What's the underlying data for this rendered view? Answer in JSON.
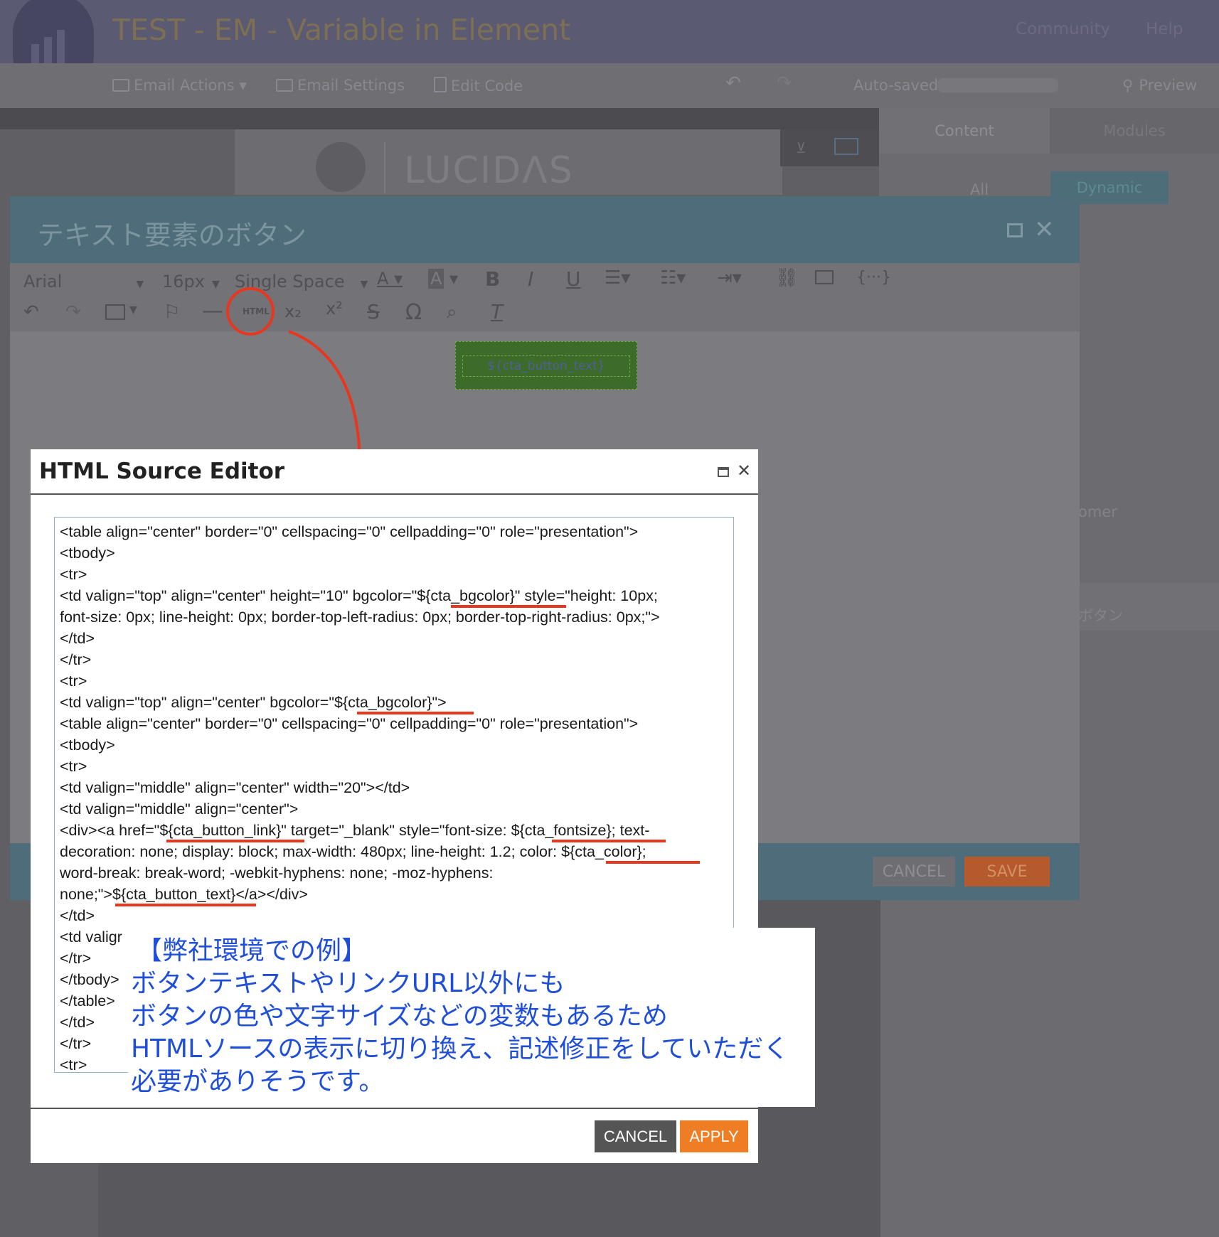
{
  "app": {
    "title": "TEST - EM - Variable in Element",
    "community": "Community",
    "help": "Help"
  },
  "toolbar": {
    "email_actions": "Email Actions ▾",
    "email_settings": "Email Settings",
    "edit_code": "Edit Code",
    "auto_saved": "Auto-saved:",
    "preview": "Preview"
  },
  "email_preview": {
    "brand": "LUCIDΛS"
  },
  "right_panel": {
    "tab_content": "Content",
    "tab_modules": "Modules",
    "filter_all": "All",
    "filter_dynamic": "Dynamic",
    "item_omer": "omer",
    "item_button": "ボタン"
  },
  "text_element_modal": {
    "title": "テキスト要素のボタン",
    "font": "Arial",
    "font_size": "16px",
    "line_spacing": "Single Space",
    "html_tool": "HTML",
    "cta_placeholder": "${cta_button_text}",
    "cancel": "CANCEL",
    "save": "SAVE"
  },
  "source_editor": {
    "title": "HTML Source Editor",
    "code_lines": [
      "<table align=\"center\" border=\"0\" cellspacing=\"0\" cellpadding=\"0\" role=\"presentation\">",
      "<tbody>",
      "<tr>",
      "<td valign=\"top\" align=\"center\" height=\"10\" bgcolor=\"${cta_bgcolor}\" style=\"height: 10px;",
      "font-size: 0px; line-height: 0px; border-top-left-radius: 0px; border-top-right-radius: 0px;\">",
      "</td>",
      "</tr>",
      "<tr>",
      "<td valign=\"top\" align=\"center\" bgcolor=\"${cta_bgcolor}\">",
      "<table align=\"center\" border=\"0\" cellspacing=\"0\" cellpadding=\"0\" role=\"presentation\">",
      "<tbody>",
      "<tr>",
      "<td valign=\"middle\" align=\"center\" width=\"20\"></td>",
      "<td valign=\"middle\" align=\"center\">",
      "<div><a href=\"${cta_button_link}\" target=\"_blank\" style=\"font-size: ${cta_fontsize}; text-",
      "decoration: none; display: block; max-width: 480px; line-height: 1.2; color: ${cta_color};",
      "word-break: break-word; -webkit-hyphens: none; -moz-hyphens:",
      "none;\">${cta_button_text}</a></div>",
      "</td>",
      "<td valigr",
      "</tr>",
      "</tbody>",
      "</table>",
      "</td>",
      "</tr>",
      "<tr>"
    ],
    "cancel": "CANCEL",
    "apply": "APPLY"
  },
  "note": {
    "lines": [
      "【弊社環境での例】",
      "ボタンテキストやリンクURL以外にも",
      "ボタンの色や文字サイズなどの変数もあるため",
      "HTMLソースの表示に切り換え、記述修正をしていただく",
      "必要がありそうです。"
    ]
  },
  "colors": {
    "annotation_red": "#e8371f",
    "note_blue": "#1f4fd8",
    "apply_orange": "#ef7d24",
    "header_purple": "#5b5a73"
  }
}
